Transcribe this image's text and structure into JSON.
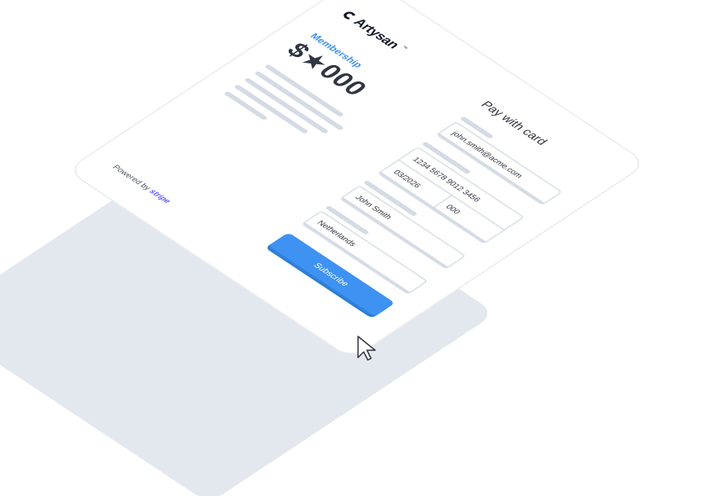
{
  "brand": {
    "name": "Artysan",
    "trademark": "™"
  },
  "product": {
    "name": "Membership",
    "price": "$★000"
  },
  "footer": {
    "powered_prefix": "Powered by",
    "powered_brand": "stripe"
  },
  "payment": {
    "title": "Pay with card",
    "email_value": "john.smith@acme.com",
    "card_number_value": "1234 5678 9012 3456",
    "card_expiry_value": "03/2026",
    "card_cvc_value": "000",
    "name_value": "John Smith",
    "country_value": "Netherlands",
    "submit_label": "Subscribe"
  },
  "colors": {
    "accent": "#3d92f2",
    "stripe_brand": "#635bff",
    "text_dark": "#30313d",
    "skeleton": "#d4dbe5",
    "shadow_plane": "#e3e8ef"
  },
  "icons": {
    "logo": "artysan-logo-icon",
    "cursor": "mouse-pointer-icon"
  }
}
